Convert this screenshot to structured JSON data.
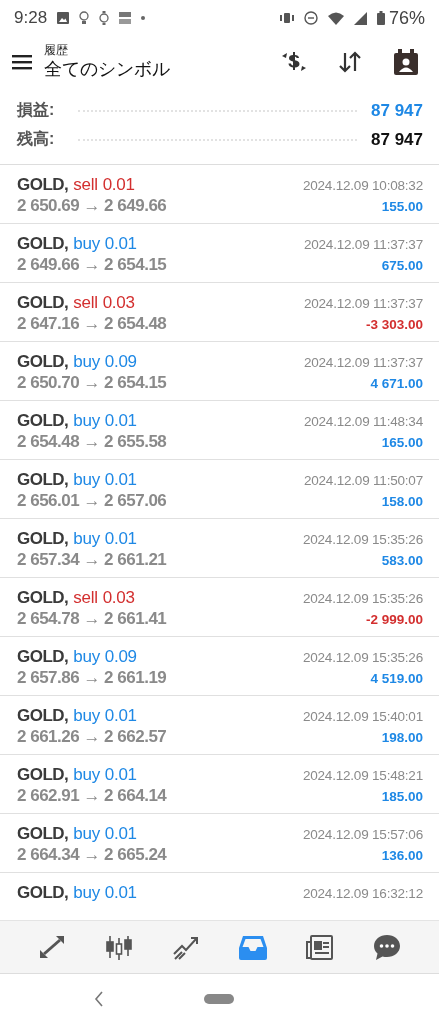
{
  "status_bar": {
    "time": "9:28",
    "battery": "76%"
  },
  "header": {
    "subtitle": "履歴",
    "title": "全てのシンボル"
  },
  "summary": [
    {
      "label": "損益:",
      "value": "87 947",
      "accent": true
    },
    {
      "label": "残高:",
      "value": "87 947",
      "accent": false
    }
  ],
  "trades": [
    {
      "symbol": "GOLD,",
      "type": "sell",
      "volume": "0.01",
      "prices": "2 650.69 → 2 649.66",
      "time": "2024.12.09 10:08:32",
      "profit": "155.00",
      "loss": false
    },
    {
      "symbol": "GOLD,",
      "type": "buy",
      "volume": "0.01",
      "prices": "2 649.66 → 2 654.15",
      "time": "2024.12.09 11:37:37",
      "profit": "675.00",
      "loss": false
    },
    {
      "symbol": "GOLD,",
      "type": "sell",
      "volume": "0.03",
      "prices": "2 647.16 → 2 654.48",
      "time": "2024.12.09 11:37:37",
      "profit": "-3 303.00",
      "loss": true
    },
    {
      "symbol": "GOLD,",
      "type": "buy",
      "volume": "0.09",
      "prices": "2 650.70 → 2 654.15",
      "time": "2024.12.09 11:37:37",
      "profit": "4 671.00",
      "loss": false
    },
    {
      "symbol": "GOLD,",
      "type": "buy",
      "volume": "0.01",
      "prices": "2 654.48 → 2 655.58",
      "time": "2024.12.09 11:48:34",
      "profit": "165.00",
      "loss": false
    },
    {
      "symbol": "GOLD,",
      "type": "buy",
      "volume": "0.01",
      "prices": "2 656.01 → 2 657.06",
      "time": "2024.12.09 11:50:07",
      "profit": "158.00",
      "loss": false
    },
    {
      "symbol": "GOLD,",
      "type": "buy",
      "volume": "0.01",
      "prices": "2 657.34 → 2 661.21",
      "time": "2024.12.09 15:35:26",
      "profit": "583.00",
      "loss": false
    },
    {
      "symbol": "GOLD,",
      "type": "sell",
      "volume": "0.03",
      "prices": "2 654.78 → 2 661.41",
      "time": "2024.12.09 15:35:26",
      "profit": "-2 999.00",
      "loss": true
    },
    {
      "symbol": "GOLD,",
      "type": "buy",
      "volume": "0.09",
      "prices": "2 657.86 → 2 661.19",
      "time": "2024.12.09 15:35:26",
      "profit": "4 519.00",
      "loss": false
    },
    {
      "symbol": "GOLD,",
      "type": "buy",
      "volume": "0.01",
      "prices": "2 661.26 → 2 662.57",
      "time": "2024.12.09 15:40:01",
      "profit": "198.00",
      "loss": false
    },
    {
      "symbol": "GOLD,",
      "type": "buy",
      "volume": "0.01",
      "prices": "2 662.91 → 2 664.14",
      "time": "2024.12.09 15:48:21",
      "profit": "185.00",
      "loss": false
    },
    {
      "symbol": "GOLD,",
      "type": "buy",
      "volume": "0.01",
      "prices": "2 664.34 → 2 665.24",
      "time": "2024.12.09 15:57:06",
      "profit": "136.00",
      "loss": false
    },
    {
      "symbol": "GOLD,",
      "type": "buy",
      "volume": "0.01",
      "time": "2024.12.09 16:32:12"
    }
  ],
  "bottom_nav": [
    {
      "kind": "arrows",
      "selected": false
    },
    {
      "kind": "candles",
      "selected": false
    },
    {
      "kind": "trend",
      "selected": false
    },
    {
      "kind": "inbox",
      "selected": true
    },
    {
      "kind": "news",
      "selected": false
    },
    {
      "kind": "chat",
      "selected": false
    }
  ]
}
